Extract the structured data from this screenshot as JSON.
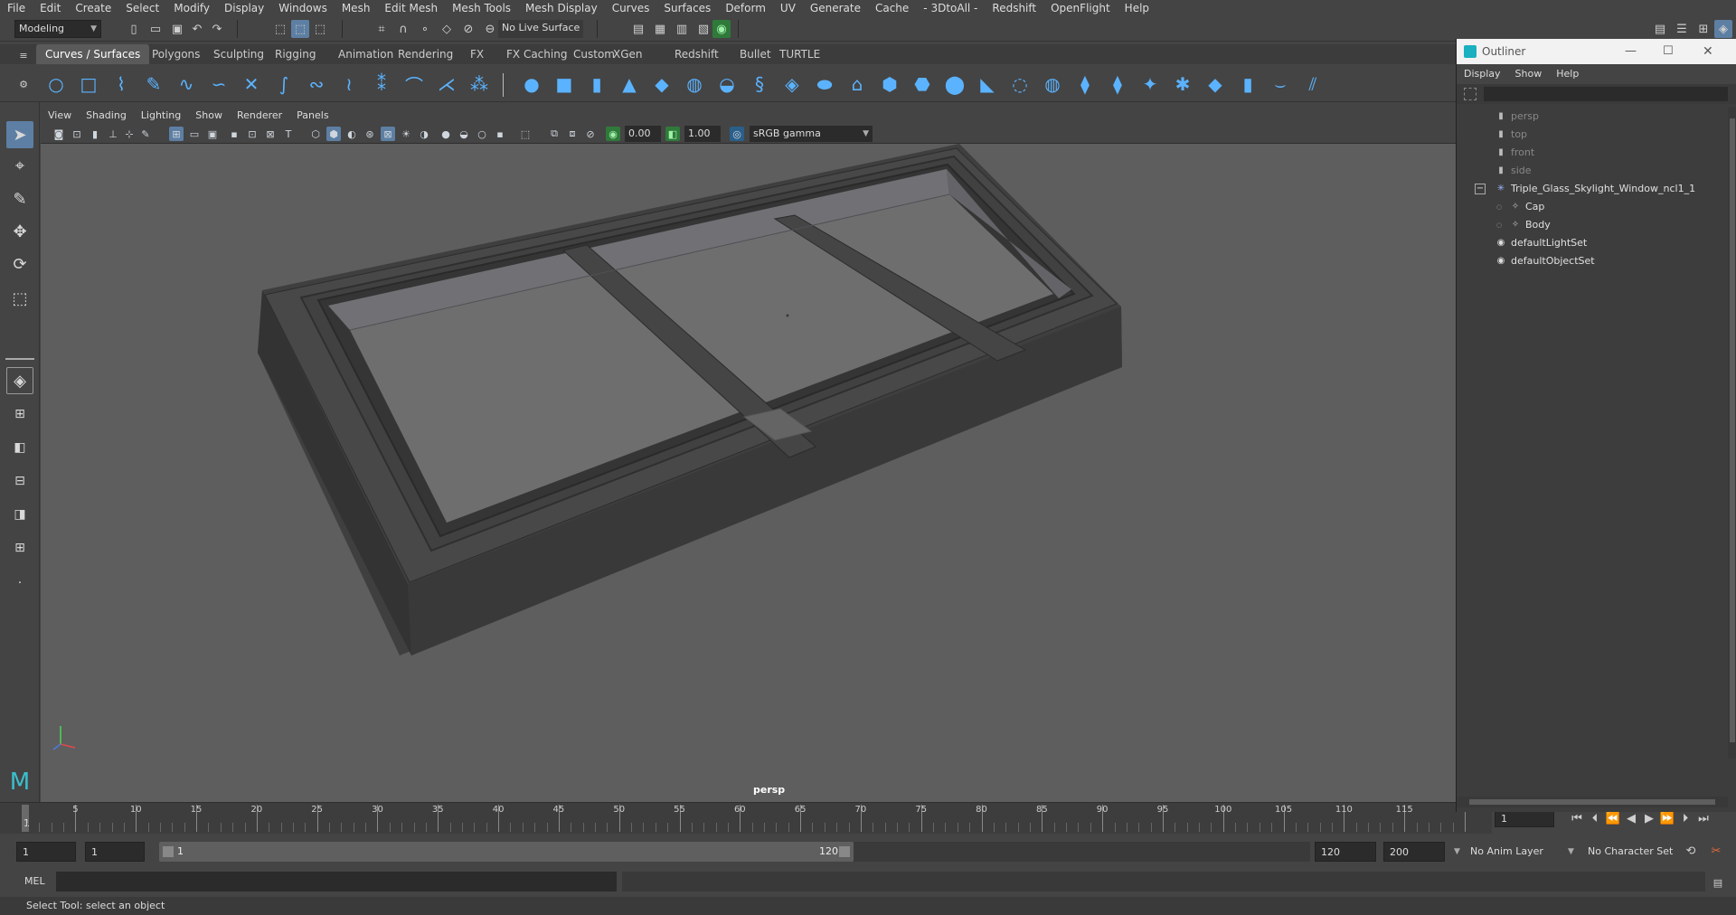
{
  "menubar": [
    "File",
    "Edit",
    "Create",
    "Select",
    "Modify",
    "Display",
    "Windows",
    "Mesh",
    "Edit Mesh",
    "Mesh Tools",
    "Mesh Display",
    "Curves",
    "Surfaces",
    "Deform",
    "UV",
    "Generate",
    "Cache",
    "- 3DtoAll -",
    "Redshift",
    "OpenFlight",
    "Help"
  ],
  "statusline": {
    "mode": "Modeling",
    "live_surface": "No Live Surface"
  },
  "shelf_tabs": [
    "Curves / Surfaces",
    "Polygons",
    "Sculpting",
    "Rigging",
    "Animation",
    "Rendering",
    "FX",
    "FX Caching",
    "Custom",
    "XGen",
    "Redshift",
    "Bullet",
    "TURTLE"
  ],
  "active_shelf_tab": "Curves / Surfaces",
  "panel_menu": [
    "View",
    "Shading",
    "Lighting",
    "Show",
    "Renderer",
    "Panels"
  ],
  "panel_bar": {
    "exposure": "0.00",
    "gamma": "1.00",
    "colorspace": "sRGB gamma"
  },
  "viewport": {
    "camera_label": "persp"
  },
  "outliner": {
    "title": "Outliner",
    "menu": [
      "Display",
      "Show",
      "Help"
    ],
    "items": [
      {
        "label": "persp",
        "type": "camera",
        "dim": true
      },
      {
        "label": "top",
        "type": "camera",
        "dim": true
      },
      {
        "label": "front",
        "type": "camera",
        "dim": true
      },
      {
        "label": "side",
        "type": "camera",
        "dim": true
      },
      {
        "label": "Triple_Glass_Skylight_Window_ncl1_1",
        "type": "group"
      },
      {
        "label": "Cap",
        "type": "mesh"
      },
      {
        "label": "Body",
        "type": "mesh"
      },
      {
        "label": "defaultLightSet",
        "type": "set"
      },
      {
        "label": "defaultObjectSet",
        "type": "set"
      }
    ]
  },
  "timeline": {
    "ticks": [
      "5",
      "10",
      "15",
      "20",
      "25",
      "30",
      "35",
      "40",
      "45",
      "50",
      "55",
      "60",
      "65",
      "70",
      "75",
      "80",
      "85",
      "90",
      "95",
      "100",
      "105",
      "110",
      "115"
    ],
    "start_label": "1",
    "current_frame": "1"
  },
  "range": {
    "start": "1",
    "playback_start": "1",
    "slider_start": "1",
    "slider_end": "120",
    "playback_end": "120",
    "end": "200",
    "anim_layer": "No Anim Layer",
    "char_set": "No Character Set"
  },
  "cmdline": {
    "label": "MEL"
  },
  "helpline": "Select Tool: select an object"
}
